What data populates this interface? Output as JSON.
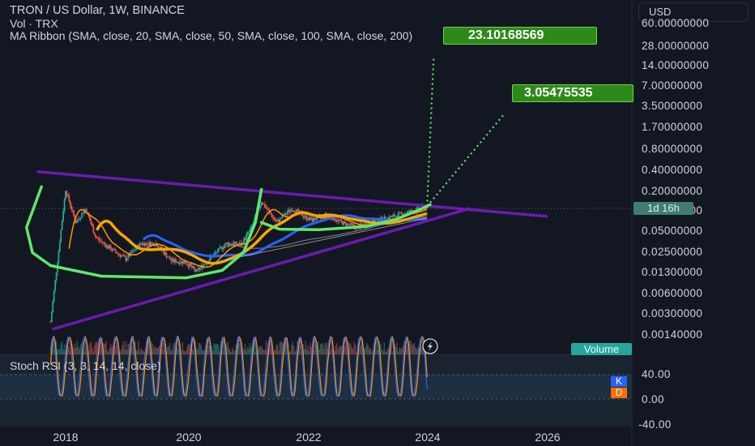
{
  "header": {
    "title": "TRON / US Dollar, 1W, BINANCE",
    "volume_label": "Vol · TRX",
    "indicator": "MA Ribbon (SMA, close, 20, SMA, close, 50, SMA, close, 100, SMA, close, 200)"
  },
  "currency_button": "USD",
  "price_axis": {
    "scale": "log",
    "labels": [
      "60.00000000",
      "28.00000000",
      "14.00000000",
      "7.00000000",
      "3.50000000",
      "1.70000000",
      "0.80000000",
      "0.40000000",
      "0.20000000",
      "0.10000000",
      "0.05000000",
      "0.02500000",
      "0.01300000",
      "0.00600000",
      "0.00300000",
      "0.00140000"
    ]
  },
  "time_axis": {
    "labels": [
      "2018",
      "2020",
      "2022",
      "2024",
      "2026"
    ]
  },
  "countdown_badge": "1d 16h",
  "volume_badge": "Volume",
  "rsi": {
    "title": "Stoch RSI (3, 3, 14, 14, close)",
    "axis_labels": [
      "40.00",
      "0.00",
      "-40.00"
    ],
    "k_label": "K",
    "d_label": "D"
  },
  "annotations": {
    "target_high": "23.10168569",
    "target_low": "3.05475535"
  },
  "colors": {
    "background": "#131722",
    "up": "#26a69a",
    "down": "#ef5350",
    "ma20": "#ff9800",
    "ma50": "#f7a600",
    "ma100": "#2962ff",
    "ma200": "#9e9e9e",
    "trend_line": "#6a1bb0",
    "drawing": "#5ee86a",
    "callout": "#2d8a19"
  },
  "chart_data": {
    "type": "line",
    "title": "TRON / US Dollar, 1W, BINANCE",
    "xlabel": "",
    "ylabel": "",
    "xlim": [
      "2017-09",
      "2026-12"
    ],
    "ylim": [
      0.0009,
      60
    ],
    "yscale": "log",
    "series": [
      {
        "name": "",
        "x": [
          "2017-10",
          "2017-12",
          "2018-01",
          "2018-03",
          "2018-05",
          "2018-07",
          "2018-10",
          "2019-01",
          "2019-04",
          "2019-07",
          "2019-10",
          "2020-01",
          "2020-03",
          "2020-06",
          "2020-09",
          "2020-12",
          "2021-02",
          "2021-04",
          "2021-07",
          "2021-10",
          "2021-12",
          "2022-02",
          "2022-05",
          "2022-08",
          "2022-11",
          "2023-02",
          "2023-05",
          "2023-08",
          "2023-11",
          "2024-01"
        ],
        "y": [
          0.0016,
          0.04,
          0.2,
          0.06,
          0.1,
          0.035,
          0.023,
          0.016,
          0.028,
          0.028,
          0.015,
          0.014,
          0.01,
          0.017,
          0.028,
          0.027,
          0.05,
          0.13,
          0.06,
          0.1,
          0.08,
          0.065,
          0.08,
          0.06,
          0.05,
          0.062,
          0.07,
          0.082,
          0.095,
          0.108
        ]
      }
    ],
    "projections": [
      {
        "label": "23.10168569",
        "from": [
          "2024-01",
          0.108
        ],
        "to": [
          "2024-01",
          23.1
        ]
      },
      {
        "label": "3.05475535",
        "from": [
          "2024-01",
          0.108
        ],
        "to": [
          "2025-03",
          3.05
        ]
      }
    ],
    "stoch_rsi_ylim": [
      -45,
      100
    ],
    "grid": false,
    "legend": "top-left"
  }
}
